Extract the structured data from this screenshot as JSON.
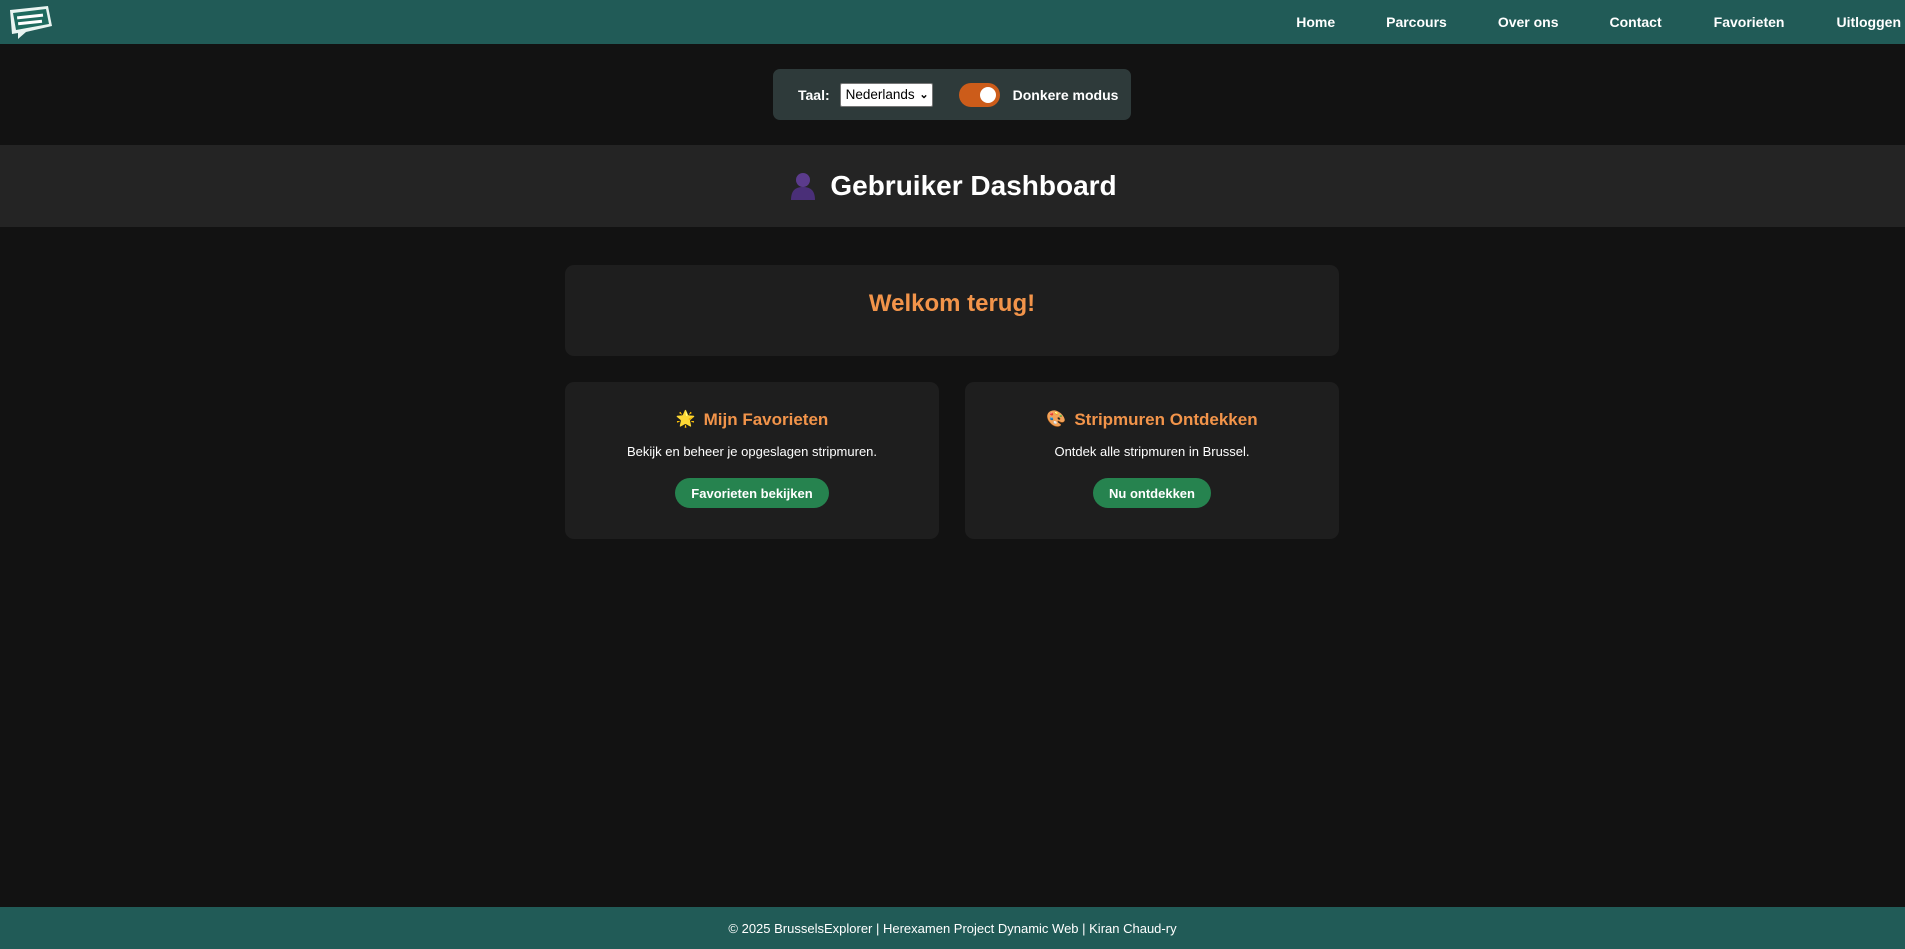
{
  "nav": {
    "logo_icon": "brussels-explorer-logo",
    "links": [
      "Home",
      "Parcours",
      "Over ons",
      "Contact",
      "Favorieten",
      "Uitloggen"
    ]
  },
  "settings": {
    "language_label": "Taal:",
    "language_selected": "Nederlands",
    "dark_mode_label": "Donkere modus",
    "dark_mode_on": true
  },
  "header": {
    "icon": "user-icon",
    "title": "Gebruiker Dashboard"
  },
  "welcome": {
    "title": "Welkom terug!"
  },
  "cards": [
    {
      "icon": "sun-icon",
      "icon_glyph": "🌟",
      "title": "Mijn Favorieten",
      "text": "Bekijk en beheer je opgeslagen stripmuren.",
      "button": "Favorieten bekijken"
    },
    {
      "icon": "palette-icon",
      "icon_glyph": "🎨",
      "title": "Stripmuren Ontdekken",
      "text": "Ontdek alle stripmuren in Brussel.",
      "button": "Nu ontdekken"
    }
  ],
  "footer": {
    "text": "© 2025 BrusselsExplorer | Herexamen Project Dynamic Web | Kiran Chaud-ry"
  },
  "colors": {
    "nav_bg": "#215b57",
    "accent_orange": "#f2944a",
    "button_green": "#26834f",
    "toggle_orange": "#cc5c1a",
    "page_bg": "#121212"
  }
}
